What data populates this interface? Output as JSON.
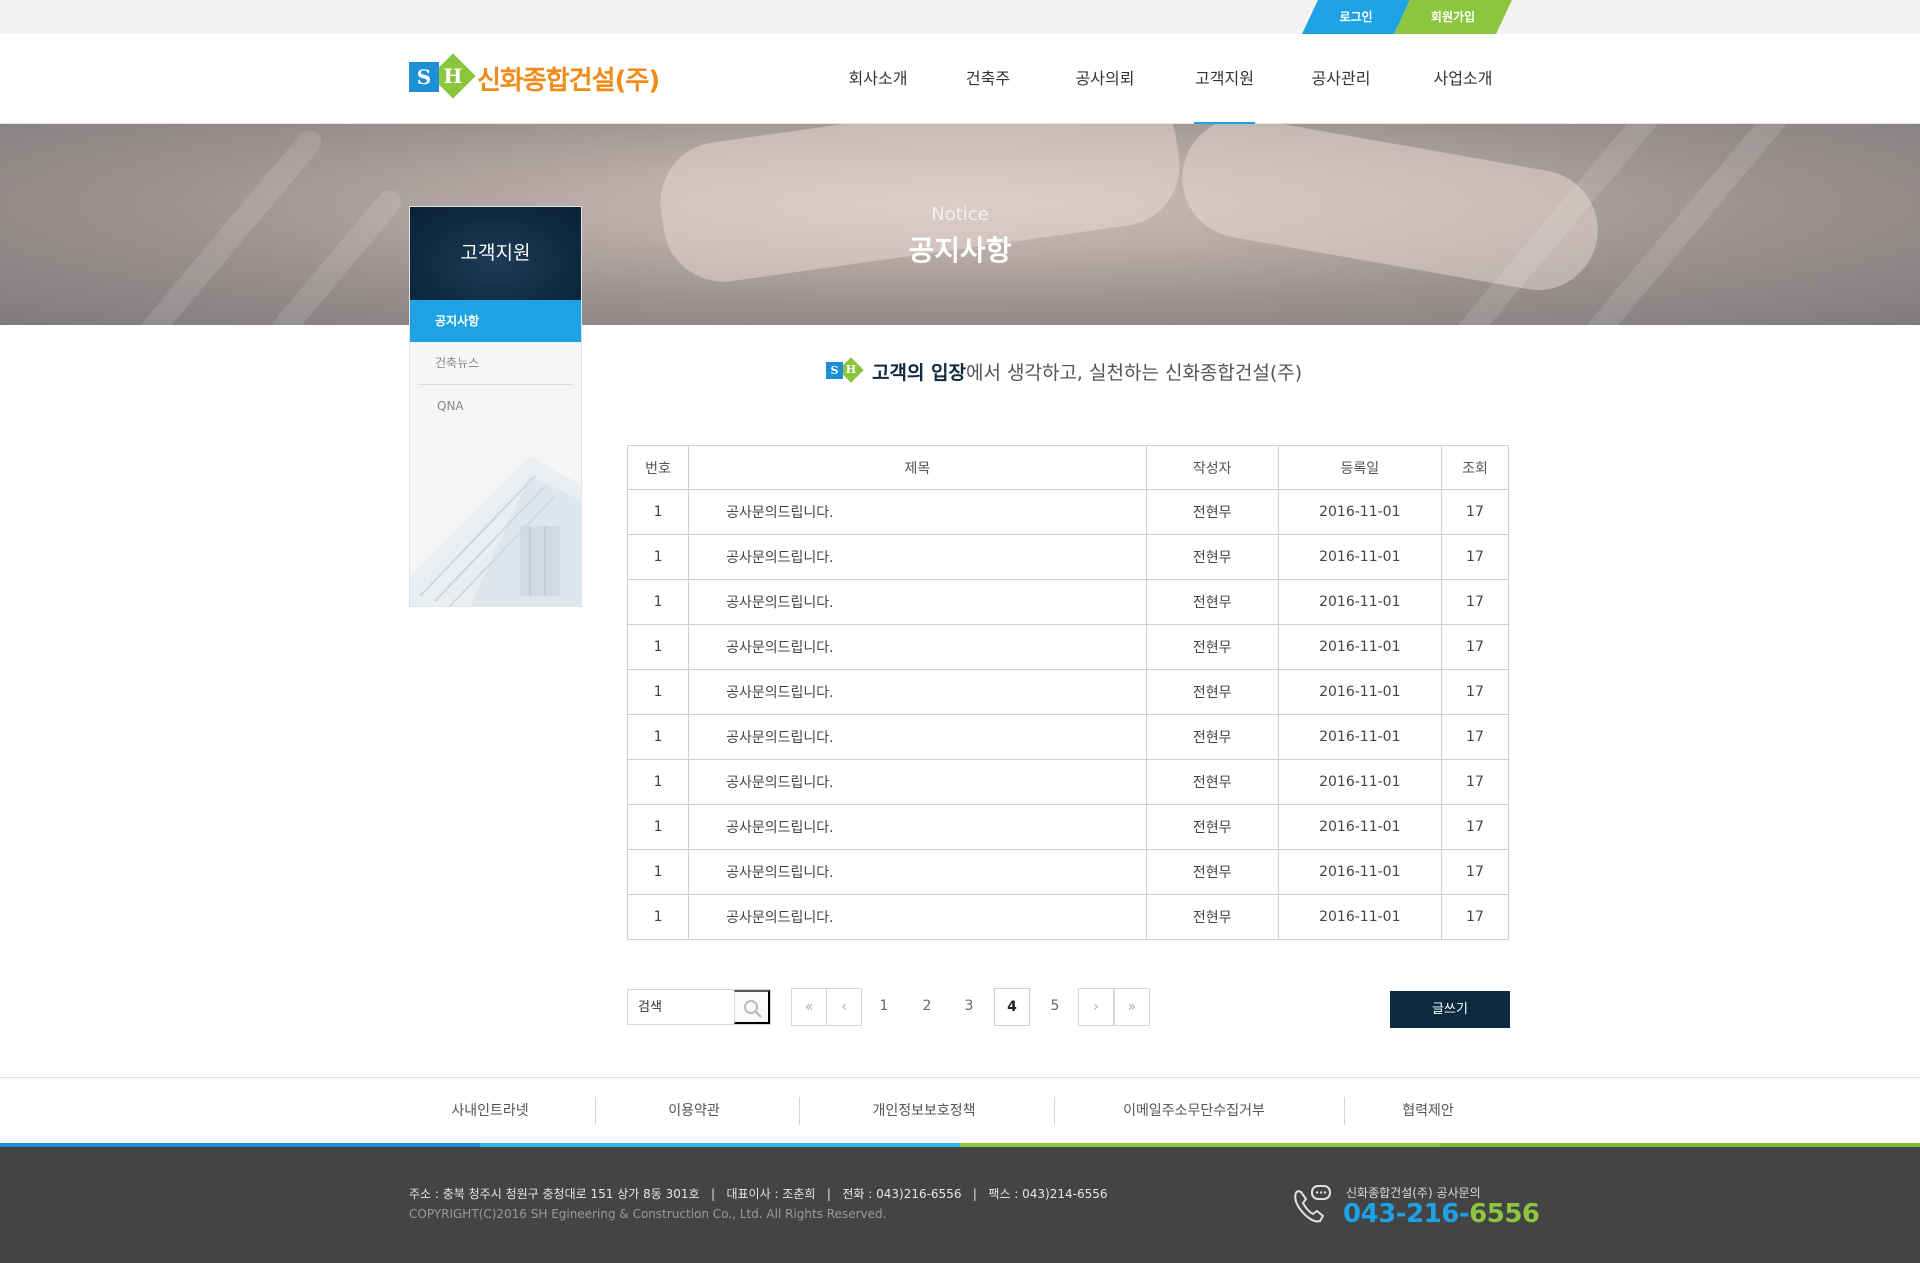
{
  "util": {
    "login": "로그인",
    "join": "회원가입"
  },
  "header": {
    "logo_text": "신화종합건설(주)",
    "logo_mark_s": "S",
    "logo_mark_h": "H",
    "nav": [
      "회사소개",
      "건축주",
      "공사의뢰",
      "고객지원",
      "공사관리",
      "사업소개"
    ],
    "active_nav": "고객지원"
  },
  "banner": {
    "subtitle": "Notice",
    "title": "공지사항"
  },
  "sidebar": {
    "title": "고객지원",
    "items": [
      {
        "label": "공지사항",
        "active": true
      },
      {
        "label": "건축뉴스",
        "active": false
      },
      {
        "label": "QNA",
        "active": false
      }
    ]
  },
  "slogan": {
    "strong": "고객의 입장",
    "rest": "에서 생각하고, 실천하는 신화종합건설(주)"
  },
  "board": {
    "headers": [
      "번호",
      "제목",
      "작성자",
      "등록일",
      "조회"
    ],
    "rows": [
      [
        "1",
        "공사문의드립니다.",
        "전현무",
        "2016-11-01",
        "17"
      ],
      [
        "1",
        "공사문의드립니다.",
        "전현무",
        "2016-11-01",
        "17"
      ],
      [
        "1",
        "공사문의드립니다.",
        "전현무",
        "2016-11-01",
        "17"
      ],
      [
        "1",
        "공사문의드립니다.",
        "전현무",
        "2016-11-01",
        "17"
      ],
      [
        "1",
        "공사문의드립니다.",
        "전현무",
        "2016-11-01",
        "17"
      ],
      [
        "1",
        "공사문의드립니다.",
        "전현무",
        "2016-11-01",
        "17"
      ],
      [
        "1",
        "공사문의드립니다.",
        "전현무",
        "2016-11-01",
        "17"
      ],
      [
        "1",
        "공사문의드립니다.",
        "전현무",
        "2016-11-01",
        "17"
      ],
      [
        "1",
        "공사문의드립니다.",
        "전현무",
        "2016-11-01",
        "17"
      ],
      [
        "1",
        "공사문의드립니다.",
        "전현무",
        "2016-11-01",
        "17"
      ]
    ]
  },
  "search": {
    "placeholder": "검색",
    "value": ""
  },
  "pagination": {
    "first": "«",
    "prev": "‹",
    "pages": [
      "1",
      "2",
      "3",
      "4",
      "5"
    ],
    "current": "4",
    "next": "›",
    "last": "»"
  },
  "write_button": "글쓰기",
  "footer_links": [
    "사내인트라넷",
    "이용약관",
    "개인정보보호정책",
    "이메일주소무단수집거부",
    "협력제안"
  ],
  "footer": {
    "address": "주소 : 충북 청주시 청원구 충청대로 151 상가 8동 301호   |   대표이사 : 조춘희   |   전화 : 043)216-6556   |   팩스 : 043)214-6556",
    "copyright": "COPYRIGHT(C)2016  SH Egineering & Construction  Co., Ltd. All Rights Reserved.",
    "phone_label": "신화종합건설(주) 공사문의",
    "phone_a": "043-216-",
    "phone_b": "6556"
  },
  "colors": {
    "accent_blue": "#1ea2e6",
    "accent_green": "#8cc63f",
    "navy": "#0b2a3f",
    "logo_orange": "#f08c1a"
  }
}
